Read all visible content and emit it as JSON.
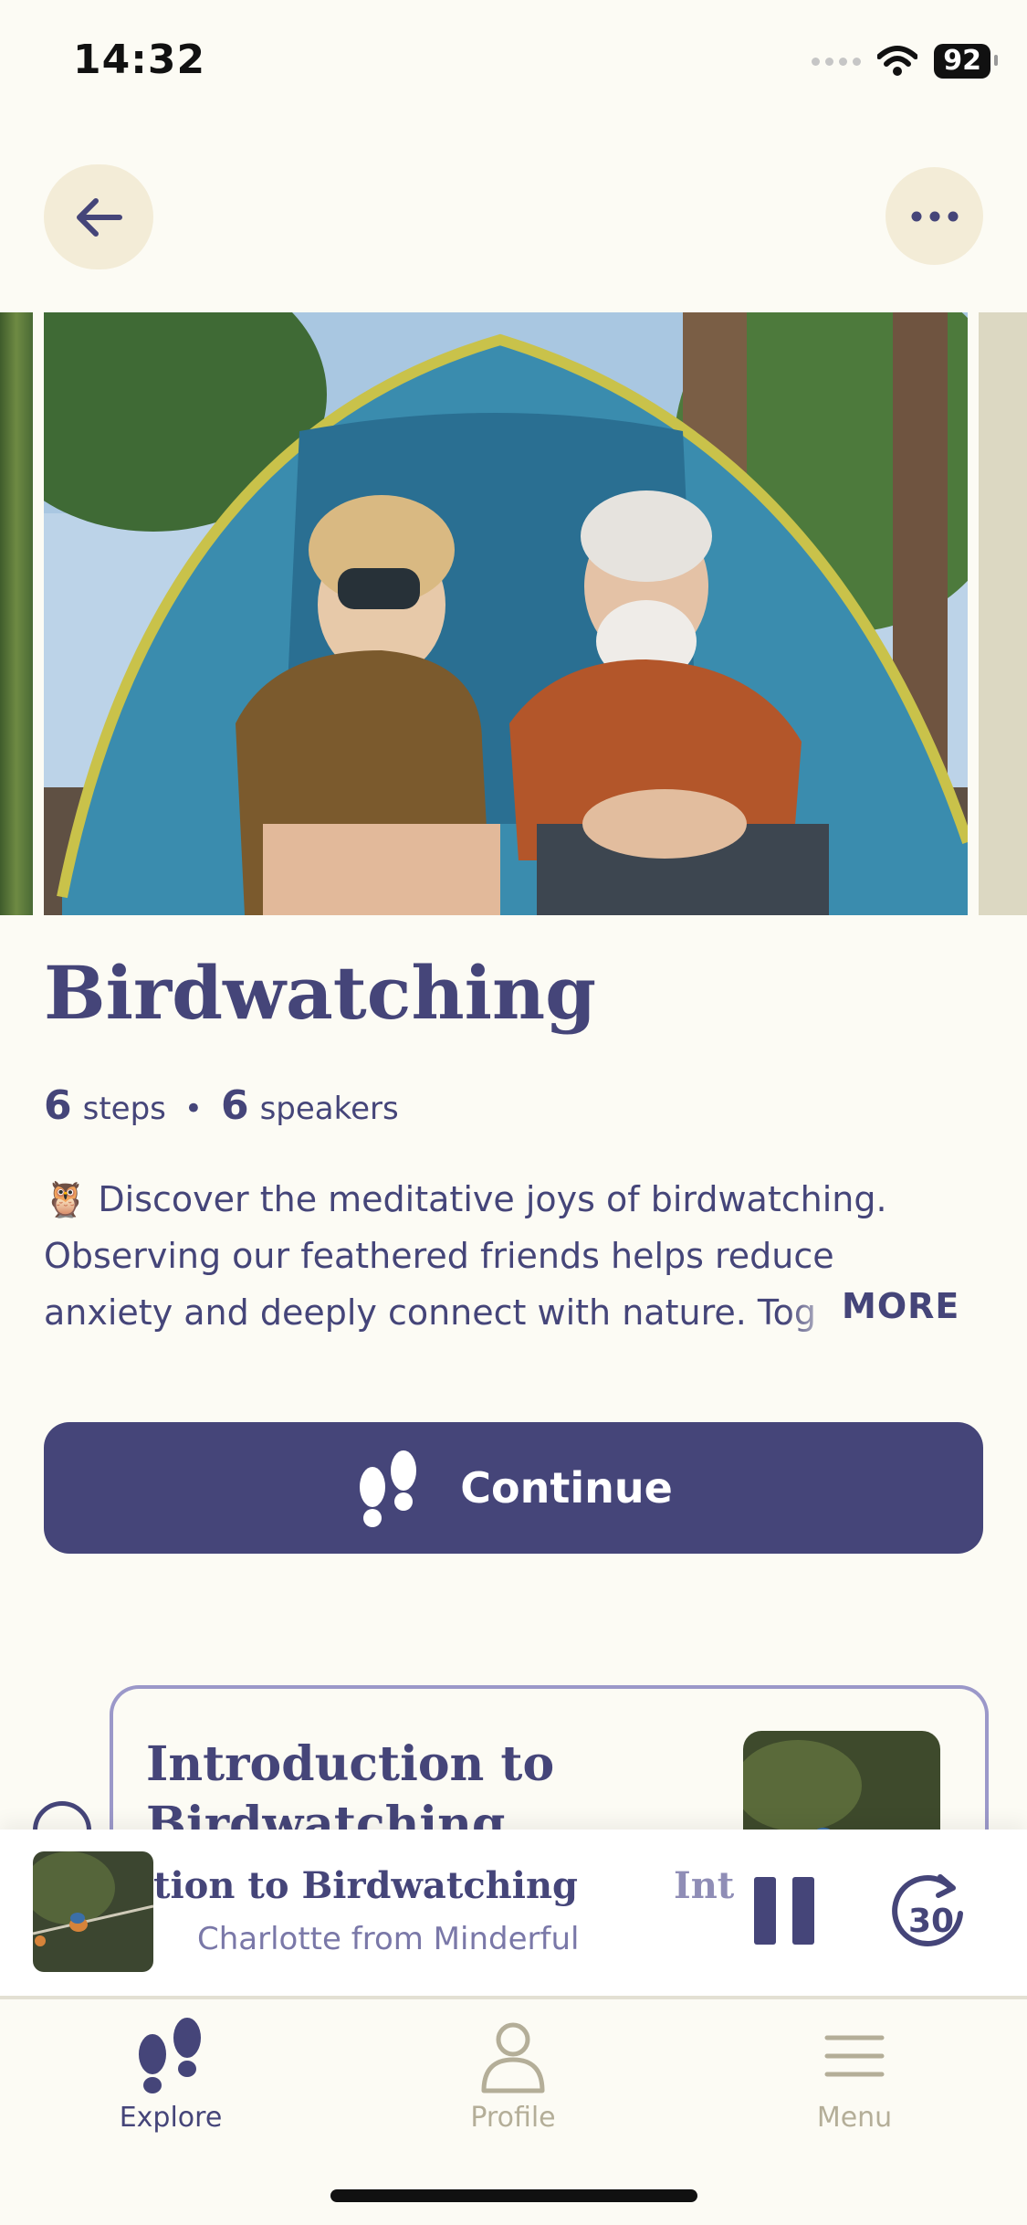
{
  "status_bar": {
    "time": "14:32",
    "battery": "92"
  },
  "path": {
    "title": "Birdwatching",
    "steps_count": "6",
    "steps_label": "steps",
    "separator": "•",
    "speakers_count": "6",
    "speakers_label": "speakers",
    "description": "🦉 Discover the meditative joys of birdwatching. Observing our feathered friends helps reduce anxiety and deeply connect with nature. Tog",
    "more_label": "MORE"
  },
  "continue_button": {
    "label": "Continue"
  },
  "step_card": {
    "title": "Introduction to Birdwatching"
  },
  "now_playing": {
    "title": "tion to Birdwatching",
    "title_next": "Int",
    "subtitle": "Charlotte from Minderful",
    "skip_seconds": "30"
  },
  "tabs": [
    {
      "label": "Explore",
      "icon": "footprints-icon",
      "active": true
    },
    {
      "label": "Profile",
      "icon": "person-icon",
      "active": false
    },
    {
      "label": "Menu",
      "icon": "menu-icon",
      "active": false
    }
  ],
  "colors": {
    "accent": "#454579",
    "background": "#fcfbf4",
    "button_bg": "#f3ecd7",
    "inactive": "#b4ae98"
  }
}
